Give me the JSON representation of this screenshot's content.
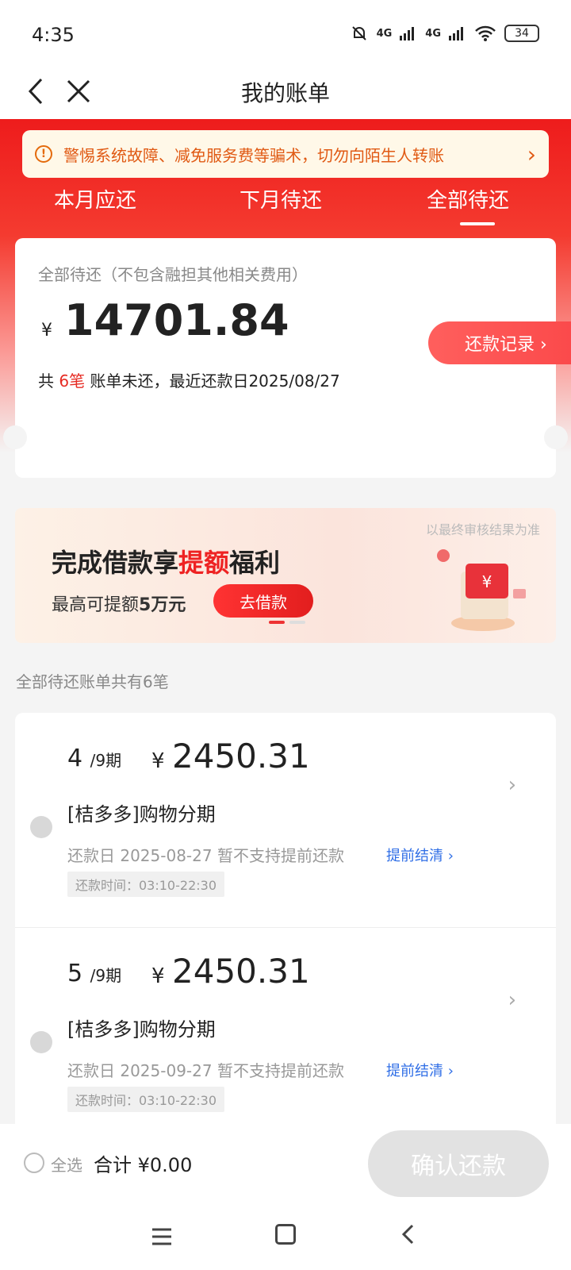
{
  "status_bar": {
    "time": "4:35",
    "signal1": "4G",
    "signal2": "4G",
    "battery": "34"
  },
  "nav": {
    "title": "我的账单",
    "back_icon": "back-chevron-icon",
    "close_icon": "close-icon"
  },
  "warning": {
    "text": "警惕系统故障、减免服务费等骗术，切勿向陌生人转账",
    "icon": "!",
    "arrow": "›"
  },
  "tabs": [
    {
      "label": "本月应还",
      "active": false
    },
    {
      "label": "下月待还",
      "active": false
    },
    {
      "label": "全部待还",
      "active": true
    }
  ],
  "summary": {
    "label": "全部待还（不包含融担其他相关费用）",
    "currency": "¥",
    "amount": "14701.84",
    "count_prefix": "共",
    "count_value": "6笔",
    "count_suffix": "账单未还，最近还款日2025/08/27",
    "record_button": "还款记录 ›"
  },
  "banner": {
    "note": "以最终审核结果为准",
    "title_before": "完成借款享",
    "title_highlight": "提额",
    "title_after": "福利",
    "subtitle": "最高可提额",
    "subtitle_bold": "5万元",
    "button": "去借款"
  },
  "list_header": "全部待还账单共有6笔",
  "bills": [
    {
      "period": "4",
      "period_total": "/9期",
      "currency": "¥",
      "amount": "2450.31",
      "name": "[桔多多]购物分期",
      "date_text": "还款日 2025-08-27 暂不支持提前还款",
      "early_link": "提前结清 ›",
      "time_text": "还款时间：03:10-22:30"
    },
    {
      "period": "5",
      "period_total": "/9期",
      "currency": "¥",
      "amount": "2450.31",
      "name": "[桔多多]购物分期",
      "date_text": "还款日 2025-09-27 暂不支持提前还款",
      "early_link": "提前结清 ›",
      "time_text": "还款时间：03:10-22:30"
    }
  ],
  "bottom": {
    "select_all": "全选",
    "total": "合计 ¥0.00",
    "confirm": "确认还款"
  },
  "colors": {
    "brand_red": "#ee1c1c",
    "warning_orange": "#e05a14",
    "link_blue": "#2f6ee6"
  }
}
